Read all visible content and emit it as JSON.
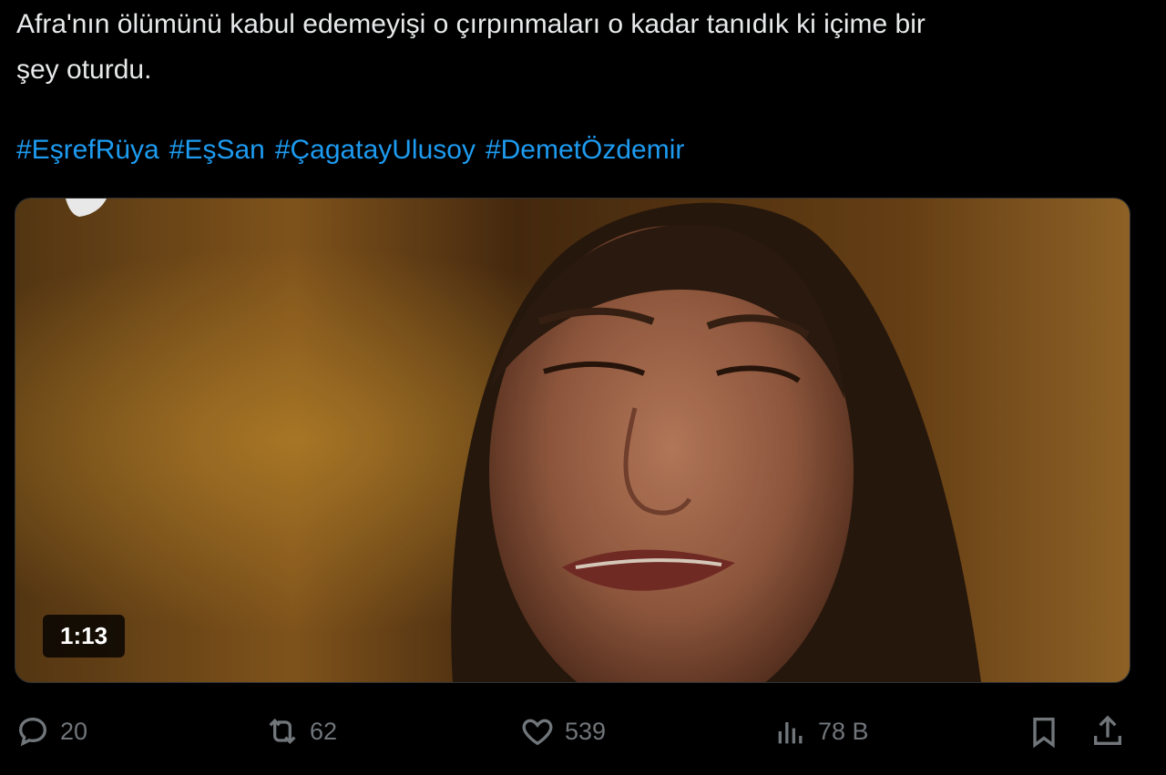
{
  "tweet": {
    "line1": "Afra'nın ölümünü kabul edemeyişi o çırpınmaları o kadar tanıdık ki içime bir",
    "line2": "şey oturdu.",
    "hashtags": [
      "#EşrefRüya",
      "#EşSan",
      "#ÇagatayUlusoy",
      "#DemetÖzdemir"
    ]
  },
  "media": {
    "duration": "1:13"
  },
  "actions": {
    "replies": "20",
    "reposts": "62",
    "likes": "539",
    "views": "78 B"
  },
  "colors": {
    "background": "#000000",
    "text": "#e7e9ea",
    "link": "#1d9bf0",
    "muted": "#71767b"
  },
  "icons": [
    "reply-icon",
    "repost-icon",
    "like-icon",
    "views-icon",
    "bookmark-icon",
    "share-icon"
  ]
}
